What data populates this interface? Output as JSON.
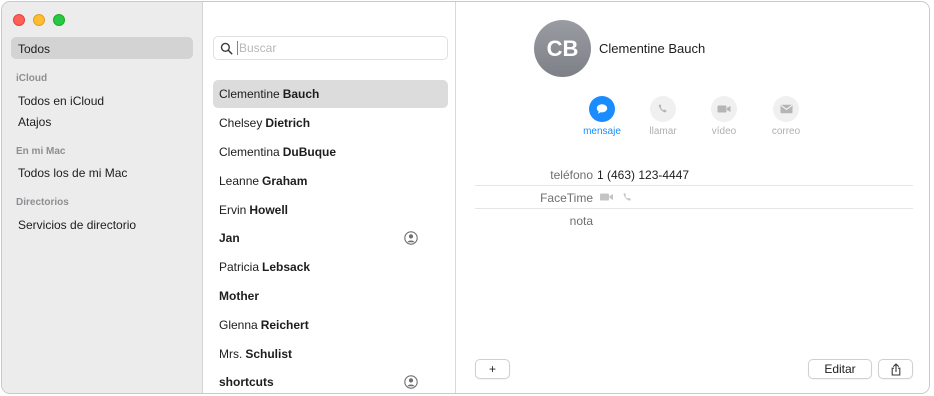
{
  "sidebar": {
    "selected": "Todos",
    "sections": [
      {
        "header": "iCloud",
        "items": [
          "Todos en iCloud",
          "Atajos"
        ]
      },
      {
        "header": "En mi Mac",
        "items": [
          "Todos los de mi Mac"
        ]
      },
      {
        "header": "Directorios",
        "items": [
          "Servicios de directorio"
        ]
      }
    ]
  },
  "search": {
    "placeholder": "Buscar"
  },
  "contacts": [
    {
      "first": "Clementine",
      "last": "Bauch"
    },
    {
      "first": "Chelsey",
      "last": "Dietrich"
    },
    {
      "first": "Clementina",
      "last": "DuBuque"
    },
    {
      "first": "Leanne",
      "last": "Graham"
    },
    {
      "first": "Ervin",
      "last": "Howell"
    },
    {
      "single": "Jan",
      "icon": "person-circle-icon"
    },
    {
      "first": "Patricia",
      "last": "Lebsack"
    },
    {
      "single": "Mother"
    },
    {
      "first": "Glenna",
      "last": "Reichert"
    },
    {
      "first": "Mrs.",
      "last": "Schulist"
    },
    {
      "single": "shortcuts",
      "icon": "person-circle-icon"
    }
  ],
  "detail": {
    "initials": "CB",
    "name": "Clementine Bauch",
    "actions": [
      {
        "label": "mensaje",
        "icon": "message-bubble-icon",
        "active": true
      },
      {
        "label": "llamar",
        "icon": "phone-icon",
        "active": false
      },
      {
        "label": "vídeo",
        "icon": "video-camera-icon",
        "active": false
      },
      {
        "label": "correo",
        "icon": "envelope-icon",
        "active": false
      }
    ],
    "fields": {
      "phone_label": "teléfono",
      "phone_value": "1 (463) 123-4447",
      "facetime_label": "FaceTime",
      "note_label": "nota"
    }
  },
  "footer": {
    "add_label": "+",
    "edit_label": "Editar",
    "share_icon": "share-icon"
  },
  "colors": {
    "accent": "#1a8cff",
    "sidebar_bg": "#ececec",
    "selection": "#dcdcdc"
  }
}
